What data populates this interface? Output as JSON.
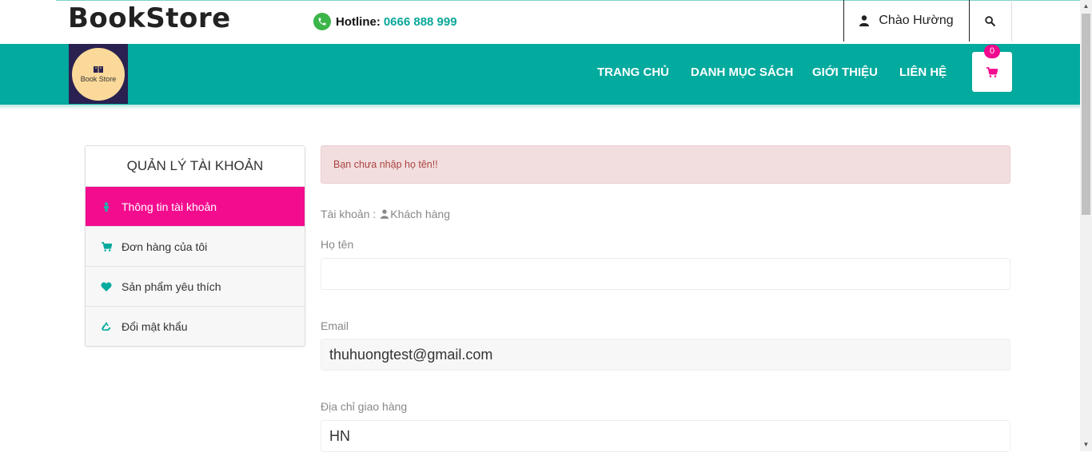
{
  "header": {
    "brand": "BookStore",
    "hotline_label": "Hotline:",
    "hotline_number": "0666 888 999",
    "greeting": "Chào Hường"
  },
  "logo": {
    "text": "Book Store"
  },
  "nav": {
    "items": [
      "TRANG CHỦ",
      "DANH MỤC SÁCH",
      "GIỚI THIỆU",
      "LIÊN HỆ"
    ],
    "cart_count": "0"
  },
  "sidebar": {
    "title": "QUẢN LÝ TÀI KHOẢN",
    "items": [
      {
        "label": "Thông tin tài khoản",
        "icon": "user-icon"
      },
      {
        "label": "Đơn hàng của tôi",
        "icon": "cart-icon"
      },
      {
        "label": "Sản phẩm yêu thích",
        "icon": "heart-icon"
      },
      {
        "label": "Đổi mật khẩu",
        "icon": "recycle-icon"
      }
    ]
  },
  "main": {
    "alert": "Bạn chưa nhập họ tên!!",
    "account_prefix": "Tài khoản :",
    "account_type": "Khách hàng",
    "fields": {
      "name_label": "Họ tên",
      "name_value": "",
      "email_label": "Email",
      "email_value": "thuhuongtest@gmail.com",
      "address_label": "Địa chỉ giao hàng",
      "address_value": "HN"
    }
  },
  "colors": {
    "primary": "#03aa9e",
    "accent": "#f40c8f",
    "alert_bg": "#f2dede",
    "alert_text": "#a94442"
  }
}
